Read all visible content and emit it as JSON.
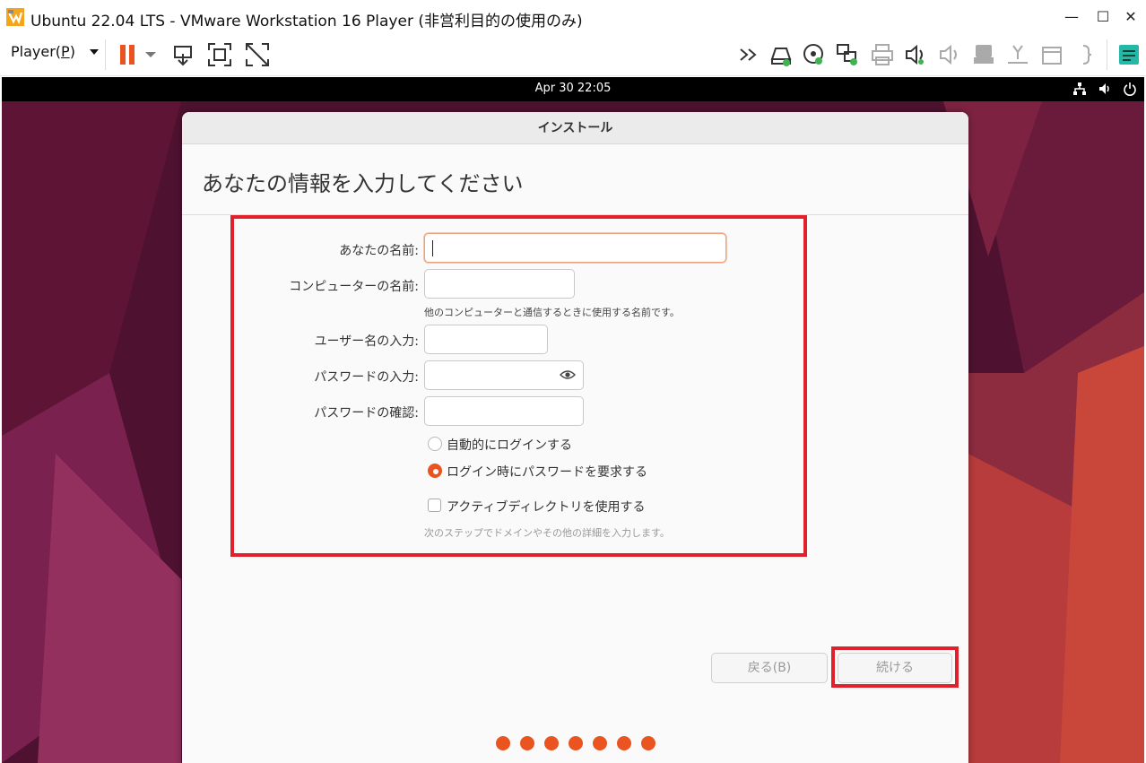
{
  "window": {
    "title": "Ubuntu 22.04 LTS - VMware Workstation 16 Player (非営利目的の使用のみ)",
    "minimize": "—",
    "maximize": "☐",
    "close": "✕"
  },
  "toolbar": {
    "player_label": "Player(",
    "player_accel": "P",
    "player_close": ")",
    "icons": [
      "pause-icon",
      "send-ctrl-alt-del-icon",
      "fullscreen-icon",
      "unity-icon",
      "more-devices-icon",
      "hard-disk-icon",
      "cd-dvd-icon",
      "network-adapter-icon",
      "printer-icon",
      "sound-card-icon",
      "sound-muted-icon",
      "usb-device-icon",
      "camera-icon",
      "removable-device-icon",
      "bracket-icon",
      "message-log-icon"
    ]
  },
  "guest": {
    "clock": "Apr 30  22:05",
    "system_icons": [
      "network-icon",
      "volume-icon",
      "power-icon"
    ]
  },
  "installer": {
    "window_title": "インストール",
    "heading": "あなたの情報を入力してください",
    "fields": {
      "your_name_label": "あなたの名前:",
      "your_name_value": "",
      "computer_name_label": "コンピューターの名前:",
      "computer_name_value": "",
      "computer_name_hint": "他のコンピューターと通信するときに使用する名前です。",
      "username_label": "ユーザー名の入力:",
      "username_value": "",
      "password_label": "パスワードの入力:",
      "password_value": "",
      "password_confirm_label": "パスワードの確認:",
      "password_confirm_value": ""
    },
    "options": {
      "auto_login": "自動的にログインする",
      "require_password": "ログイン時にパスワードを要求する",
      "active_directory": "アクティブディレクトリを使用する",
      "active_directory_hint": "次のステップでドメインやその他の詳細を入力します。"
    },
    "buttons": {
      "back": "戻る(B)",
      "continue": "続ける"
    },
    "progress": {
      "current_step": 7,
      "total_steps": 7
    }
  },
  "colors": {
    "accent": "#e95420",
    "highlight_box": "#e0202a"
  }
}
